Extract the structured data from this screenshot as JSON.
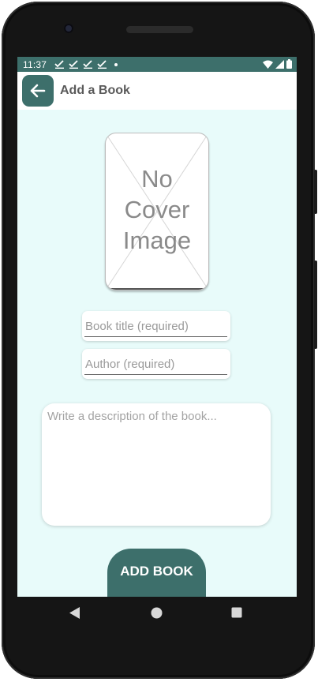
{
  "status_bar": {
    "time": "11:37",
    "notification_icons": [
      "check-icon",
      "check-icon",
      "check-icon",
      "check-icon",
      "dot-icon"
    ],
    "system_icons": [
      "wifi-icon",
      "signal-icon",
      "battery-icon"
    ]
  },
  "app_bar": {
    "back_icon": "arrow-left-icon",
    "title": "Add a Book"
  },
  "cover": {
    "placeholder_text": "No\nCover\nImage"
  },
  "form": {
    "title_placeholder": "Book title (required)",
    "author_placeholder": "Author (required)",
    "description_placeholder": "Write a description of the book..."
  },
  "submit_label": "ADD BOOK",
  "nav_bar": [
    "back-triangle-icon",
    "home-circle-icon",
    "recents-square-icon"
  ],
  "colors": {
    "primary": "#3d6f6b",
    "background": "#e8fbfa",
    "surface": "#ffffff"
  }
}
